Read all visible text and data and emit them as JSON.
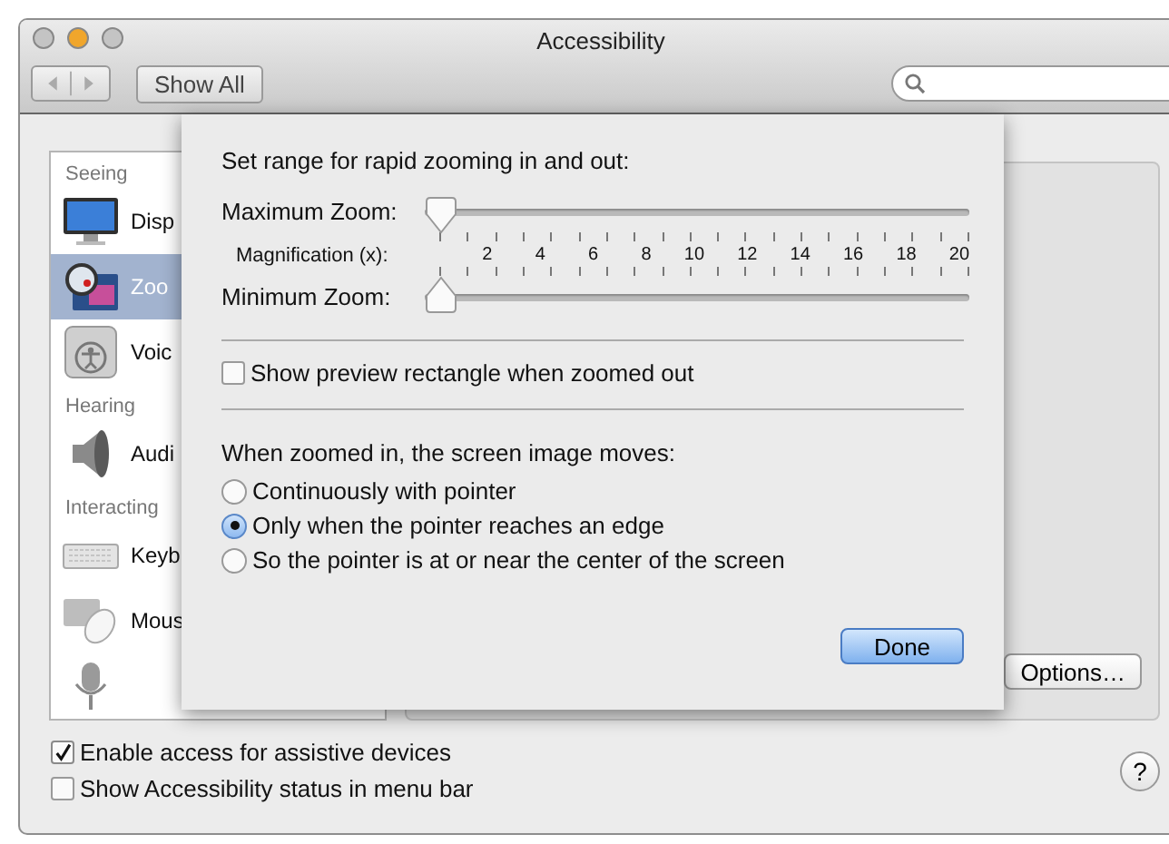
{
  "window": {
    "title": "Accessibility",
    "traffic_lights": [
      {
        "color": "#c4c4c4"
      },
      {
        "color": "#f0a62c"
      },
      {
        "color": "#c4c4c4"
      }
    ]
  },
  "toolbar": {
    "show_all": "Show All"
  },
  "sidebar": {
    "sections": [
      {
        "heading": "Seeing",
        "items": [
          {
            "label": "Disp",
            "kind": "display",
            "selected": false
          },
          {
            "label": "Zoo",
            "kind": "zoom",
            "selected": true
          },
          {
            "label": "Voic",
            "kind": "voiceover",
            "selected": false
          }
        ]
      },
      {
        "heading": "Hearing",
        "items": [
          {
            "label": "Audi",
            "kind": "audio",
            "selected": false
          }
        ]
      },
      {
        "heading": "Interacting",
        "items": [
          {
            "label": "Keyb",
            "kind": "keyboard",
            "selected": false
          },
          {
            "label": "Mous",
            "kind": "mouse",
            "selected": false
          },
          {
            "kind": "speakable",
            "selected": false
          }
        ]
      }
    ]
  },
  "options_button": "Options…",
  "zoom_sheet": {
    "title": "Set range for rapid zooming in and out:",
    "maximum": {
      "label": "Maximum Zoom:",
      "level": 0
    },
    "magnification": {
      "label": "Magnification (x):",
      "values": [
        "2",
        "4",
        "6",
        "8",
        "10",
        "12",
        "14",
        "16",
        "18",
        "20"
      ]
    },
    "minimum": {
      "label": "Minimum Zoom:",
      "level": 0
    },
    "preview": {
      "label": "Show preview rectangle when zoomed out",
      "checked": false
    },
    "movement": {
      "heading": "When zoomed in, the screen image moves:",
      "options": [
        {
          "label": "Continuously with pointer",
          "selected": false
        },
        {
          "label": "Only when the pointer reaches an edge",
          "selected": true
        },
        {
          "label": "So the pointer is at or near the center of the screen",
          "selected": false
        }
      ]
    },
    "done": "Done"
  },
  "bottom": {
    "checkboxes": [
      {
        "label": "Enable access for assistive devices",
        "checked": true
      },
      {
        "label": "Show Accessibility status in menu bar",
        "checked": false
      }
    ],
    "help": "?"
  }
}
